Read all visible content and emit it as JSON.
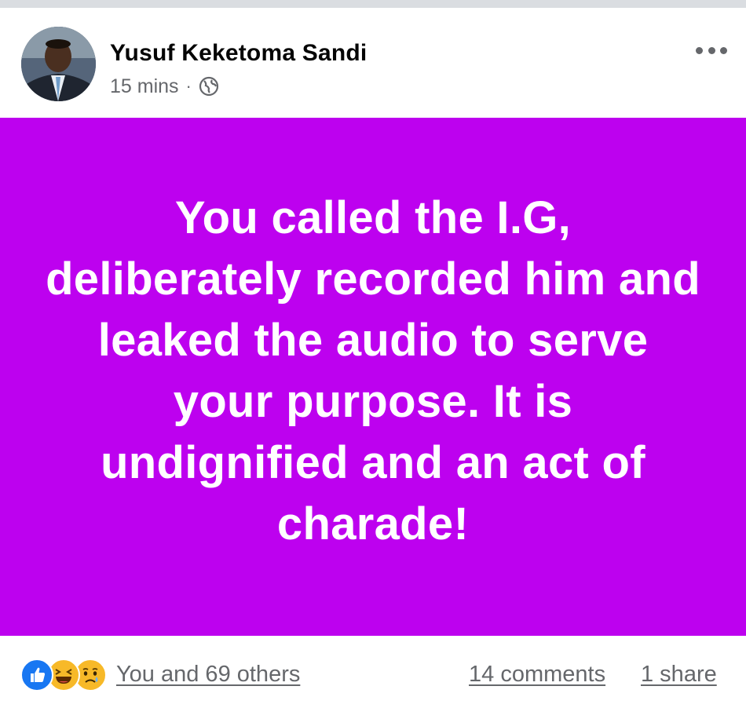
{
  "post": {
    "author": "Yusuf Keketoma Sandi",
    "time": "15 mins",
    "separator": "·",
    "privacy_icon": "globe-icon",
    "more_icon": "more-options-icon",
    "background_color": "#bd01ef",
    "text": "You called the I.G, deliberately recorded him and leaked the audio to serve your purpose. It is undignified and an act of charade!"
  },
  "footer": {
    "reaction_icons": [
      "like-icon",
      "haha-icon",
      "sad-icon"
    ],
    "reaction_summary": "You and 69 others",
    "comments": "14 comments",
    "shares": "1 share"
  }
}
